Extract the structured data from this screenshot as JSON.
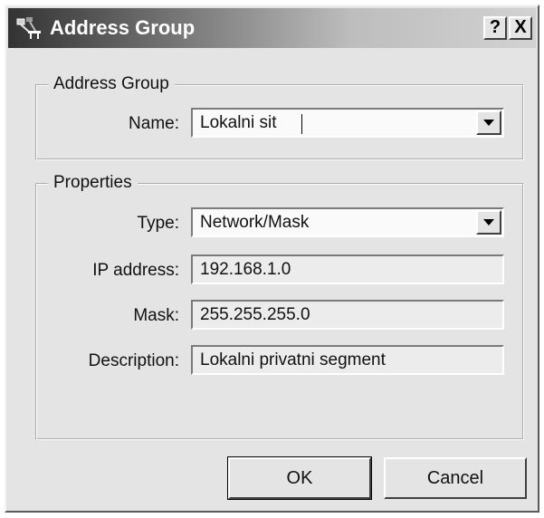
{
  "window": {
    "title": "Address Group",
    "help_button": "?",
    "close_button": "X"
  },
  "address_group": {
    "legend": "Address Group",
    "name_label": "Name:",
    "name_value": "Lokalni sit"
  },
  "properties": {
    "legend": "Properties",
    "type_label": "Type:",
    "type_value": "Network/Mask",
    "ip_label": "IP address:",
    "ip_value": "192.168.1.0",
    "mask_label": "Mask:",
    "mask_value": "255.255.255.0",
    "description_label": "Description:",
    "description_value": "Lokalni privatni segment"
  },
  "buttons": {
    "ok": "OK",
    "cancel": "Cancel"
  }
}
